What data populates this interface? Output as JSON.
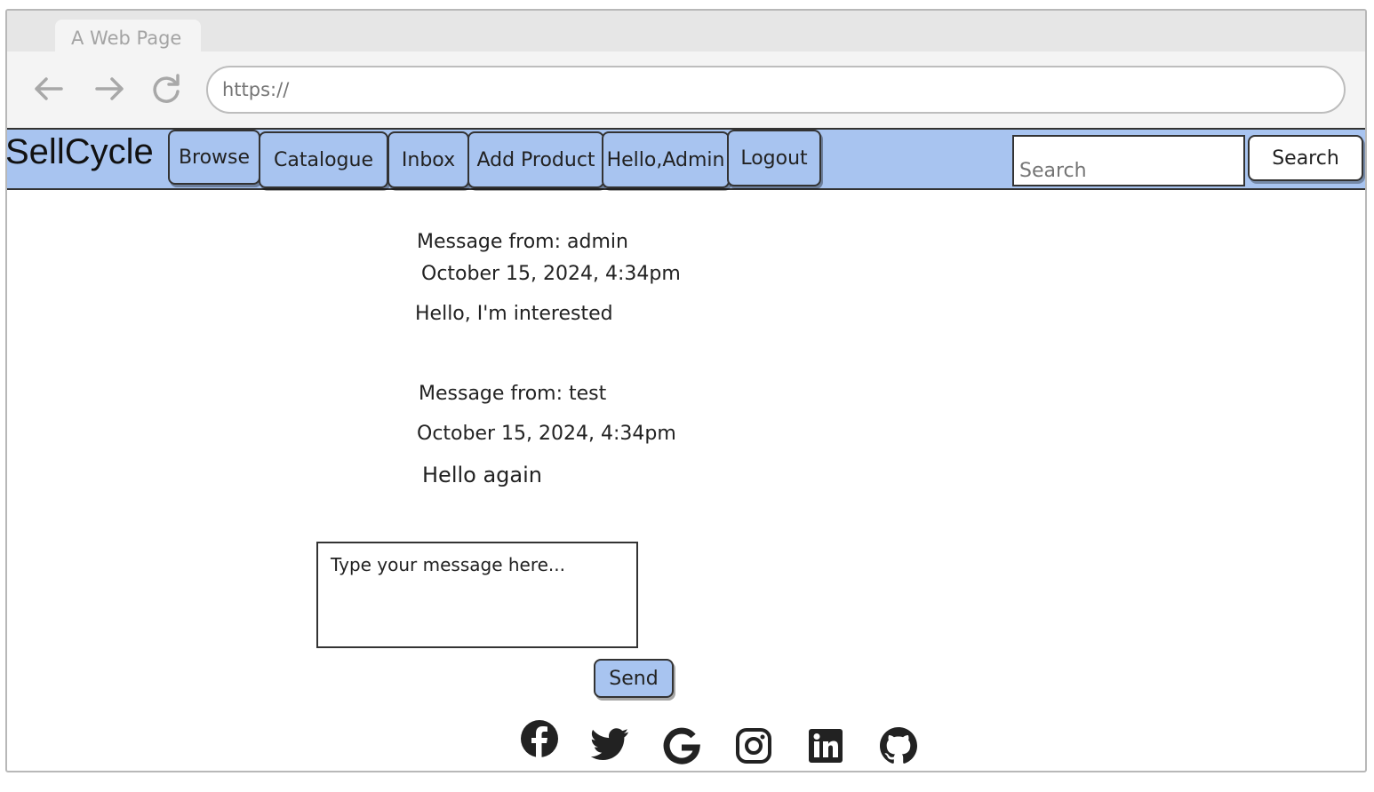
{
  "browser": {
    "tab_title": "A Web Page",
    "url_placeholder": "https://"
  },
  "navbar": {
    "brand": "SellCycle",
    "items": [
      {
        "label": "Browse"
      },
      {
        "label": "Catalogue"
      },
      {
        "label": "Inbox"
      },
      {
        "label": "Add Product"
      },
      {
        "label": "Hello,Admin"
      },
      {
        "label": "Logout"
      }
    ],
    "search_placeholder": "Search",
    "search_button": "Search"
  },
  "messages": [
    {
      "from": "Message from: admin",
      "timestamp": "October 15, 2024, 4:34pm",
      "body": "Hello, I'm interested"
    },
    {
      "from": "Message from: test",
      "timestamp": "October 15, 2024, 4:34pm",
      "body": "Hello again"
    }
  ],
  "compose": {
    "placeholder": "Type your message here...",
    "send_label": "Send"
  },
  "footer": {
    "icons": [
      "facebook-icon",
      "twitter-icon",
      "google-icon",
      "instagram-icon",
      "linkedin-icon",
      "github-icon"
    ]
  },
  "colors": {
    "navbar_bg": "#a8c4f0",
    "chrome_bg": "#f4f4f4",
    "tabstrip_bg": "#e6e6e6"
  }
}
